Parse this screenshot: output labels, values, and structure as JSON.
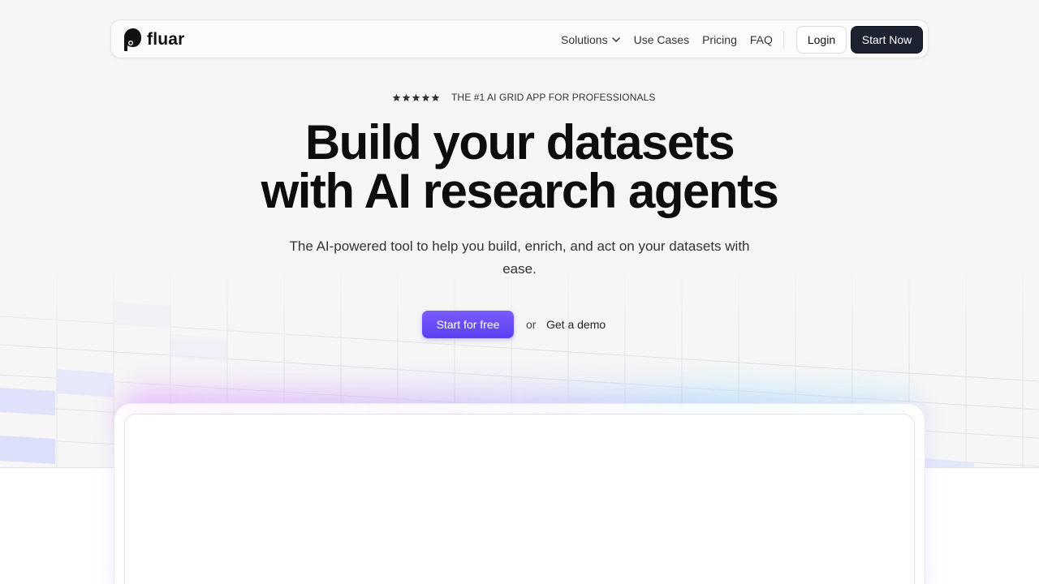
{
  "brand": {
    "name": "fluar"
  },
  "nav": {
    "links": [
      {
        "label": "Solutions",
        "has_dropdown": true
      },
      {
        "label": "Use Cases"
      },
      {
        "label": "Pricing"
      },
      {
        "label": "FAQ"
      }
    ],
    "login_label": "Login",
    "start_now_label": "Start Now"
  },
  "hero": {
    "rating_stars": 5,
    "rating_text": "THE #1 AI GRID APP FOR PROFESSIONALS",
    "headline_line1": "Build your datasets",
    "headline_line2": "with AI research agents",
    "subtitle": "The AI-powered tool to help you build, enrich, and act on your datasets with ease.",
    "cta_primary": "Start for free",
    "cta_or": "or",
    "cta_secondary": "Get a demo"
  },
  "colors": {
    "accent": "#6a4cf5",
    "dark_button": "#1d2230",
    "hero_bg": "#f6f6f6"
  }
}
